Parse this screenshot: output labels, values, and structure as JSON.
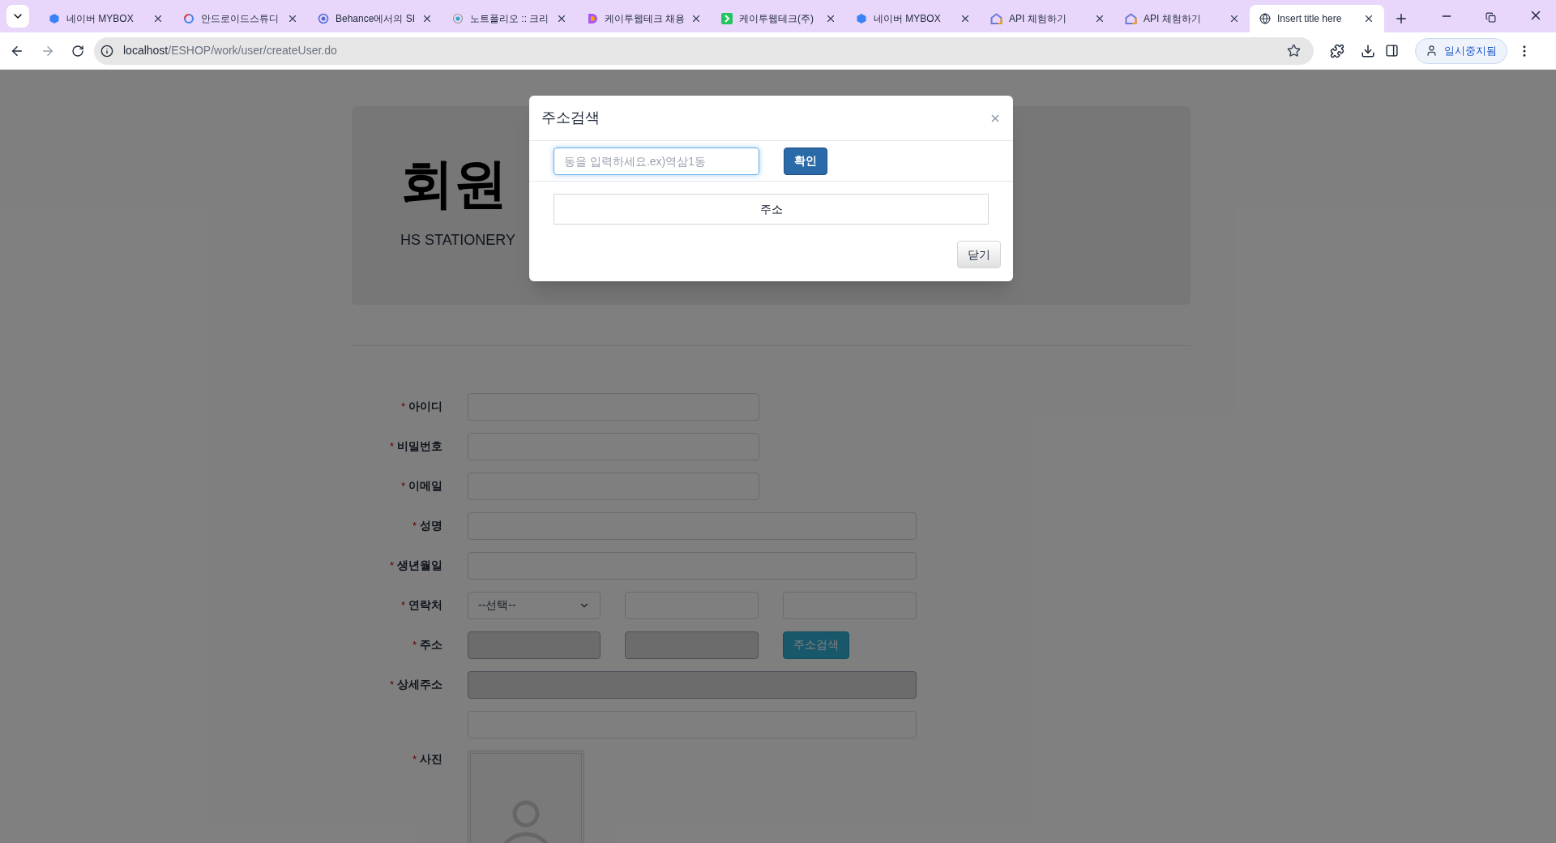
{
  "browser": {
    "tabs": [
      {
        "title": "네이버 MYBOX",
        "kind": "cube",
        "selected": false
      },
      {
        "title": "안드로이드스튜디",
        "kind": "google",
        "selected": false
      },
      {
        "title": "Behance에서의 SI",
        "kind": "ring",
        "selected": false
      },
      {
        "title": "노트폴리오 :: 크리",
        "kind": "dot",
        "selected": false
      },
      {
        "title": "케이투웹테크 채용",
        "kind": "d",
        "selected": false
      },
      {
        "title": "케이투웹테크(주)",
        "kind": "green",
        "selected": false
      },
      {
        "title": "네이버 MYBOX",
        "kind": "cube",
        "selected": false
      },
      {
        "title": "API 체험하기",
        "kind": "house",
        "selected": false
      },
      {
        "title": "API 체험하기",
        "kind": "house",
        "selected": false
      },
      {
        "title": "Insert title here",
        "kind": "globe",
        "selected": true
      }
    ],
    "address": {
      "host": "localhost",
      "path": "/ESHOP/work/user/createUser.do"
    },
    "profile": "일시중지됨"
  },
  "page": {
    "header": {
      "title": "회원",
      "subtitle": "HS STATIONERY"
    },
    "rows": [
      {
        "mark": "*",
        "label": "아이디",
        "kind": "short",
        "disabled": false
      },
      {
        "mark": "*",
        "label": "비밀번호",
        "kind": "short",
        "disabled": false
      },
      {
        "mark": "*",
        "label": "이메일",
        "kind": "short",
        "disabled": false
      },
      {
        "mark": "*",
        "label": "성명",
        "kind": "long",
        "disabled": false
      },
      {
        "mark": "*",
        "label": "생년월일",
        "kind": "long",
        "disabled": false
      },
      {
        "mark": "*",
        "label": "연락처",
        "kind": "phone",
        "select": "--선택--"
      },
      {
        "mark": "*",
        "label": "주소",
        "kind": "address",
        "disabled": true,
        "button": "주소검색"
      },
      {
        "mark": "*",
        "label": "상세주소",
        "kind": "long",
        "disabled": true
      },
      {
        "kind": "long",
        "disabled": false
      },
      {
        "mark": "*",
        "label": "사진",
        "kind": "photo"
      }
    ]
  },
  "modal": {
    "title": "주소검색",
    "placeholder": "동을 입력하세요.ex)역삼1동",
    "confirm": "확인",
    "column": "주소",
    "close": "닫기"
  }
}
